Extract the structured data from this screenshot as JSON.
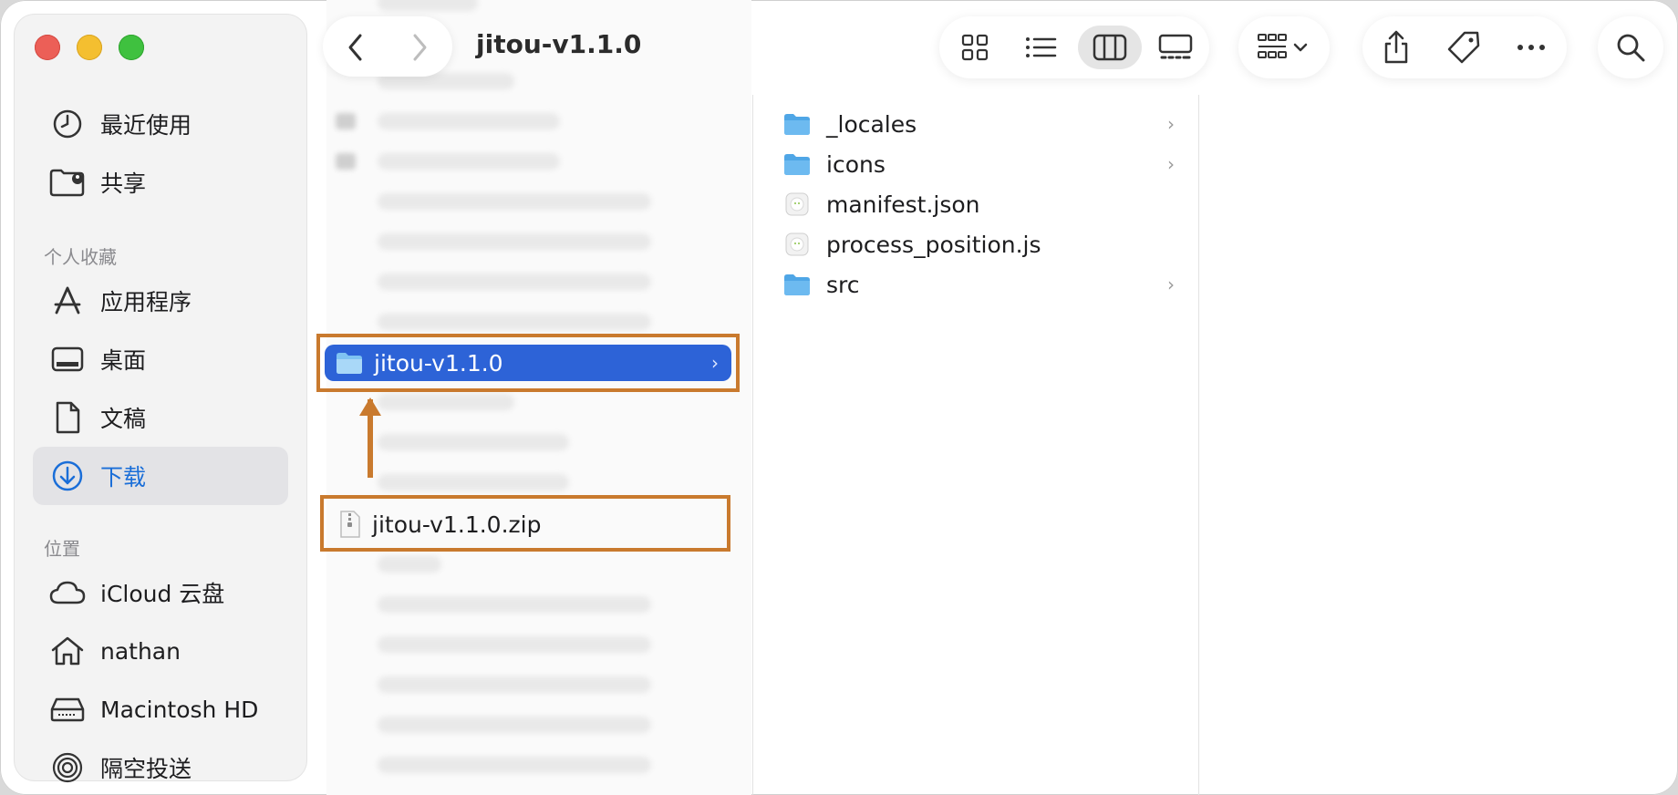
{
  "window": {
    "title": "jitou-v1.1.0"
  },
  "sidebar": {
    "top_items": [
      {
        "label": "最近使用",
        "icon": "clock-icon"
      },
      {
        "label": "共享",
        "icon": "shared-folder-icon"
      }
    ],
    "favorites_header": "个人收藏",
    "favorites": [
      {
        "label": "应用程序",
        "icon": "applications-icon"
      },
      {
        "label": "桌面",
        "icon": "desktop-icon"
      },
      {
        "label": "文稿",
        "icon": "document-icon"
      },
      {
        "label": "下载",
        "icon": "download-icon",
        "selected": true
      }
    ],
    "locations_header": "位置",
    "locations": [
      {
        "label": "iCloud 云盘",
        "icon": "cloud-icon"
      },
      {
        "label": "nathan",
        "icon": "home-icon"
      },
      {
        "label": "Macintosh HD",
        "icon": "disk-icon"
      },
      {
        "label": "隔空投送",
        "icon": "airdrop-icon"
      }
    ]
  },
  "column1": {
    "selected_folder": "jitou-v1.1.0",
    "zip_file": "jitou-v1.1.0.zip"
  },
  "column2": {
    "items": [
      {
        "label": "_locales",
        "type": "folder",
        "has_children": true
      },
      {
        "label": "icons",
        "type": "folder",
        "has_children": true
      },
      {
        "label": "manifest.json",
        "type": "file",
        "has_children": false
      },
      {
        "label": "process_position.js",
        "type": "file",
        "has_children": false
      },
      {
        "label": "src",
        "type": "folder",
        "has_children": true
      }
    ]
  },
  "colors": {
    "selection": "#2d63d7",
    "annotation": "#c97a2e",
    "folder": "#5ab0ec",
    "accent": "#1a6ed8"
  }
}
